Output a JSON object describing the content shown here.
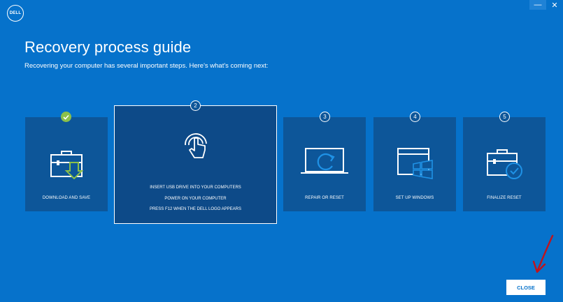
{
  "brand": {
    "logo_text": "DELL"
  },
  "window": {
    "minimize_glyph": "—",
    "close_glyph": "✕"
  },
  "header": {
    "title": "Recovery process guide",
    "subtitle": "Recovering your computer has several important steps. Here's what's coming next:"
  },
  "steps": [
    {
      "badge": "✓",
      "label": "DOWNLOAD AND SAVE",
      "status": "complete",
      "icon": "toolbox-download-icon"
    },
    {
      "badge": "2",
      "status": "active",
      "icon": "touch-hand-icon",
      "instructions": [
        "INSERT USB DRIVE INTO YOUR COMPUTERS",
        "POWER ON YOUR COMPUTER",
        "PRESS F12 WHEN THE DELL LOGO APPEARS"
      ]
    },
    {
      "badge": "3",
      "label": "REPAIR OR RESET",
      "status": "pending",
      "icon": "laptop-reset-icon"
    },
    {
      "badge": "4",
      "label": "SET UP WINDOWS",
      "status": "pending",
      "icon": "windows-setup-icon"
    },
    {
      "badge": "5",
      "label": "FINALIZE RESET",
      "status": "pending",
      "icon": "toolbox-check-icon"
    }
  ],
  "footer": {
    "close_label": "CLOSE"
  },
  "colors": {
    "background": "#0672cb",
    "card": "#0d5699",
    "check": "#8cc04a",
    "annotation_arrow": "#c0141c"
  }
}
